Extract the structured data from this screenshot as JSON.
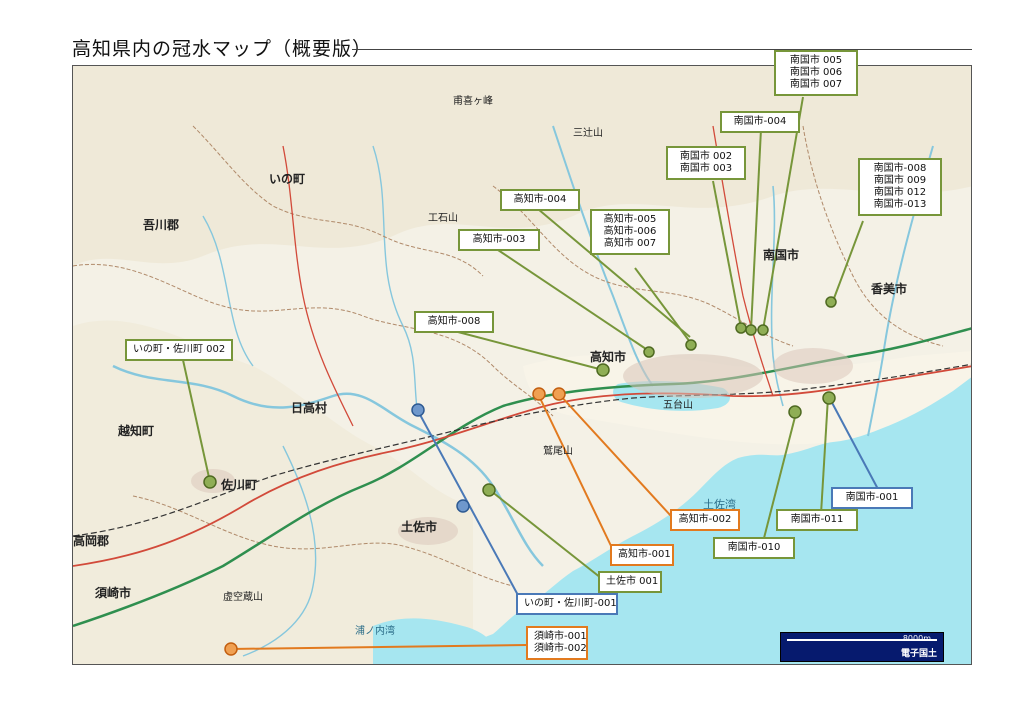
{
  "page": {
    "title": "高知県内の冠水マップ（概要版）"
  },
  "map": {
    "sea_color": "#a6e6f0",
    "land_color": "#f4f1e6",
    "palette": {
      "green": "#77963a",
      "orange": "#e27a1f",
      "blue": "#4a79b7"
    },
    "place_names": [
      {
        "id": "ino",
        "text": "いの町"
      },
      {
        "id": "agawa",
        "text": "吾川郡"
      },
      {
        "id": "hidaka",
        "text": "日高村"
      },
      {
        "id": "ochi",
        "text": "越知町"
      },
      {
        "id": "sakawa",
        "text": "佐川町"
      },
      {
        "id": "takaoka",
        "text": "高岡郡"
      },
      {
        "id": "susaki",
        "text": "須崎市"
      },
      {
        "id": "tosa",
        "text": "土佐市"
      },
      {
        "id": "kochi",
        "text": "高知市"
      },
      {
        "id": "nankoku",
        "text": "南国市"
      },
      {
        "id": "kami",
        "text": "香美市"
      },
      {
        "id": "sannodake",
        "text": "三辻山"
      },
      {
        "id": "mt2",
        "text": "工石山"
      },
      {
        "id": "mt3",
        "text": "虚空蔵山"
      },
      {
        "id": "mt4",
        "text": "鷲尾山"
      },
      {
        "id": "mt5",
        "text": "五台山"
      },
      {
        "id": "mt6",
        "text": "甫喜ヶ峰"
      },
      {
        "id": "mt7",
        "text": "土佐湾"
      },
      {
        "id": "mt8",
        "text": "浦ノ内湾"
      }
    ],
    "scale": {
      "distance": "8000m",
      "credit": "電子国土"
    }
  },
  "callouts": [
    {
      "id": "nankoku-005-007",
      "color": "green",
      "lines": [
        "南国市 005",
        "南国市 006",
        "南国市 007"
      ]
    },
    {
      "id": "nankoku-004",
      "color": "green",
      "lines": [
        "南国市-004"
      ]
    },
    {
      "id": "nankoku-002-003",
      "color": "green",
      "lines": [
        "南国市 002",
        "南国市 003"
      ]
    },
    {
      "id": "nankoku-008-013",
      "color": "green",
      "lines": [
        "南国市-008",
        "南国市 009",
        "南国市 012",
        "南国市-013"
      ]
    },
    {
      "id": "kochi-004",
      "color": "green",
      "lines": [
        "高知市-004"
      ]
    },
    {
      "id": "kochi-005-007",
      "color": "green",
      "lines": [
        "高知市-005",
        "高知市-006",
        "高知市 007"
      ]
    },
    {
      "id": "kochi-003",
      "color": "green",
      "lines": [
        "高知市-003"
      ]
    },
    {
      "id": "kochi-008",
      "color": "green",
      "lines": [
        "高知市-008"
      ]
    },
    {
      "id": "ino-sakawa-002",
      "color": "green",
      "lines": [
        "いの町・佐川町 002"
      ]
    },
    {
      "id": "nankoku-001",
      "color": "blue",
      "lines": [
        "南国市-001"
      ]
    },
    {
      "id": "nankoku-011",
      "color": "green",
      "lines": [
        "南国市-011"
      ]
    },
    {
      "id": "kochi-002",
      "color": "orange",
      "lines": [
        "高知市-002"
      ]
    },
    {
      "id": "nankoku-010",
      "color": "green",
      "lines": [
        "南国市-010"
      ]
    },
    {
      "id": "kochi-001",
      "color": "orange",
      "lines": [
        "高知市-001"
      ]
    },
    {
      "id": "tosa-001",
      "color": "green",
      "lines": [
        "土佐市 001"
      ]
    },
    {
      "id": "ino-sakawa-001",
      "color": "blue",
      "lines": [
        "いの町・佐川町-001"
      ]
    },
    {
      "id": "susaki-001-002",
      "color": "orange",
      "lines": [
        "須崎市-001",
        "須崎市-002"
      ]
    }
  ]
}
